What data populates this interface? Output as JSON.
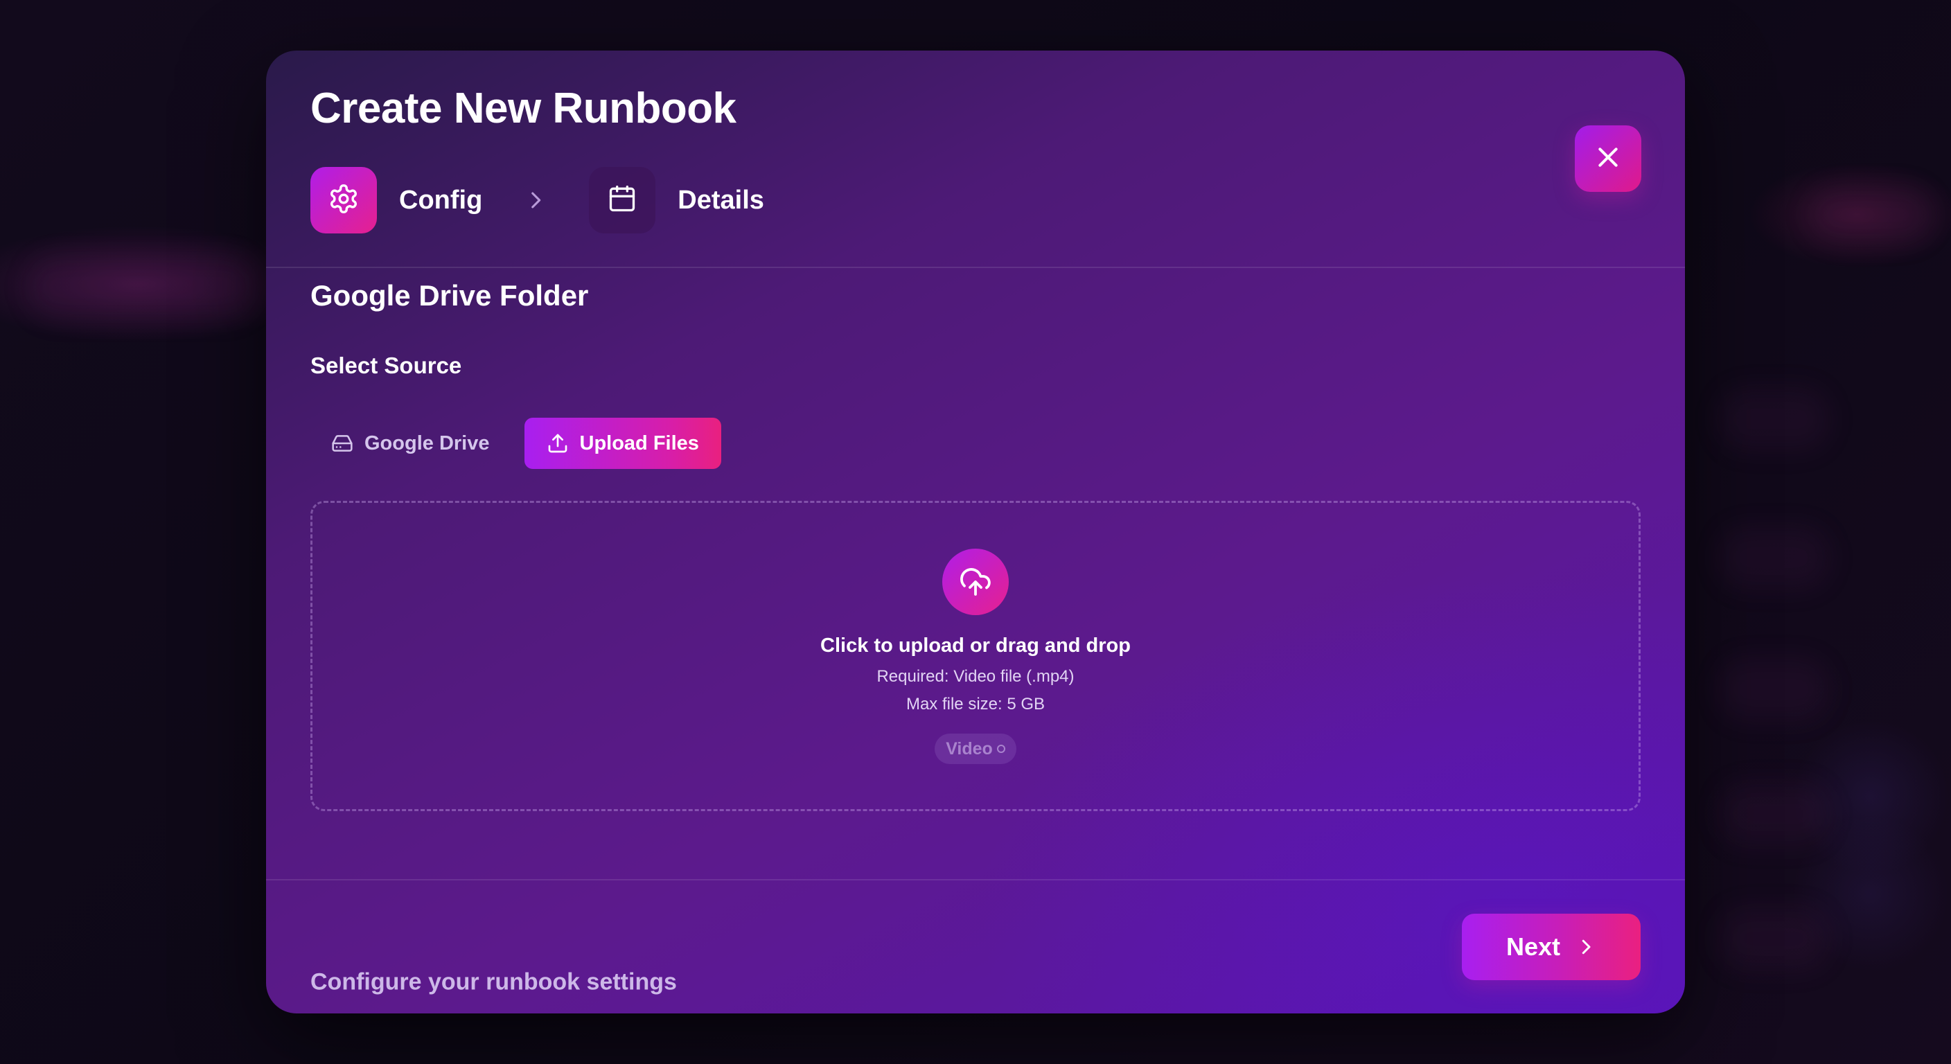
{
  "modal": {
    "title": "Create New Runbook",
    "close_icon": "close-icon"
  },
  "steps": [
    {
      "label": "Config",
      "icon": "gear-icon",
      "active": true
    },
    {
      "label": "Details",
      "icon": "calendar-icon",
      "active": false
    }
  ],
  "step_separator_icon": "chevron-right-icon",
  "section": {
    "title": "Google Drive Folder",
    "source_label": "Select Source"
  },
  "source_tabs": [
    {
      "label": "Google Drive",
      "icon": "drive-icon",
      "selected": false
    },
    {
      "label": "Upload Files",
      "icon": "upload-icon",
      "selected": true
    }
  ],
  "dropzone": {
    "icon": "cloud-upload-icon",
    "title": "Click to upload or drag and drop",
    "required": "Required: Video file (.mp4)",
    "max_size": "Max file size: 5 GB",
    "badge": "Video"
  },
  "footer": {
    "hint": "Configure your runbook settings",
    "next_label": "Next",
    "next_icon": "chevron-right-icon"
  },
  "colors": {
    "accent_start": "#a81ff0",
    "accent_end": "#ea2080",
    "modal_top": "#2a1a4a",
    "modal_bottom": "#5a15b2"
  }
}
